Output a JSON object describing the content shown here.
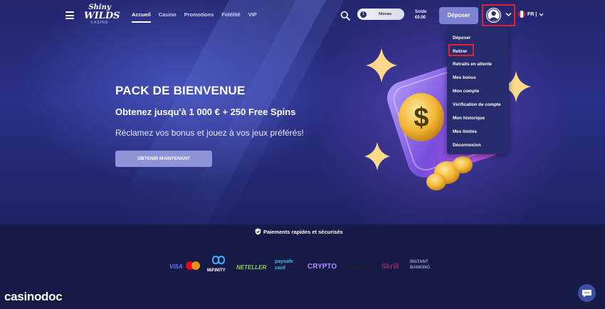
{
  "header": {
    "logo": {
      "line1": "Shiny",
      "line2": "WILDS",
      "line3": "CASINO"
    },
    "nav": [
      "Accueil",
      "Casino",
      "Promotions",
      "Fidélité",
      "VIP"
    ],
    "level_label": "Niveau",
    "level_badge": "1",
    "balance_label": "Solde",
    "balance_value": "€0.00",
    "deposit_button": "Déposer",
    "language": "FR |"
  },
  "dropdown": {
    "items": [
      "Déposer",
      "Retirer",
      "Retraits en attente",
      "Mes bonus",
      "Mon compte",
      "Vérification de compte",
      "Mon historique",
      "Mes limites",
      "Déconnexion"
    ]
  },
  "hero": {
    "title": "PACK DE BIENVENUE",
    "subtitle": "Obtenez jusqu'à 1 000 € + 250 Free Spins",
    "description": "Réclamez vos bonus et jouez à vos jeux préférés!",
    "cta": "OBTENIR MAINTENANT"
  },
  "footer": {
    "secure_text": "Paiements rapides et sécurisés",
    "payment_methods": [
      "VISA",
      "MiFINITY",
      "NETELLER",
      "paysafe card",
      "CRYPTO",
      "Revolut",
      "Skrill",
      "INSTANT BANKING"
    ]
  },
  "watermark": "casinodoc",
  "colors": {
    "accent": "#7e82d3",
    "highlight": "#e0242f",
    "background": "#23266e"
  }
}
